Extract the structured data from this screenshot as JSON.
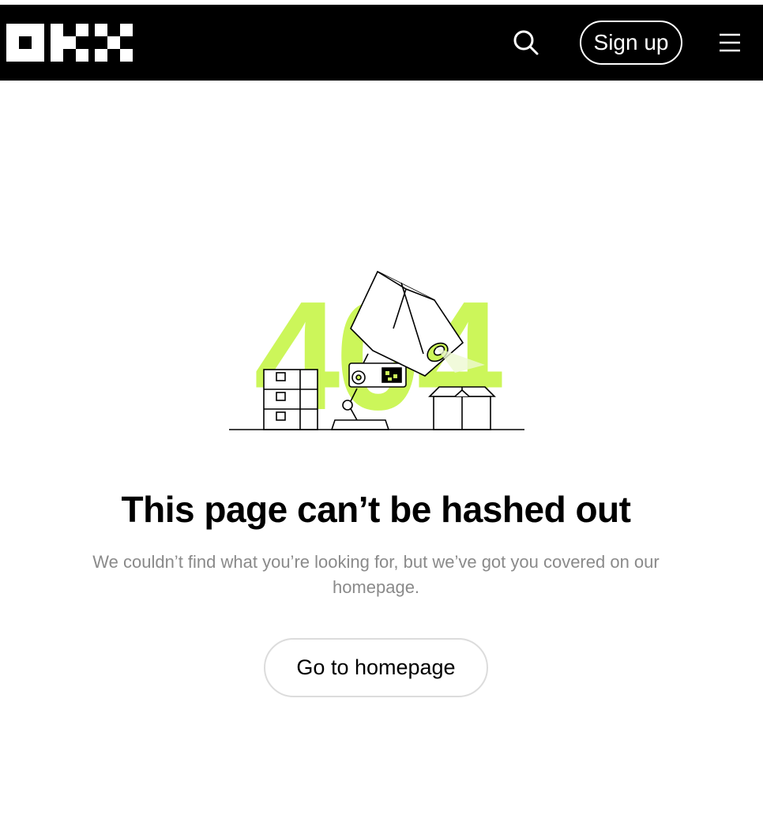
{
  "header": {
    "logo_text": "OKX",
    "signup_label": "Sign up",
    "search_icon": "search-icon",
    "menu_icon": "hamburger-menu-icon"
  },
  "error": {
    "code": "404",
    "title": "This page can’t be hashed out",
    "message": "We couldn’t find what you’re looking for, but we’ve got you covered on our homepage.",
    "button_label": "Go to homepage"
  },
  "colors": {
    "header_bg": "#000000",
    "accent": "#CCF65A",
    "muted_text": "#8A8A8A"
  }
}
